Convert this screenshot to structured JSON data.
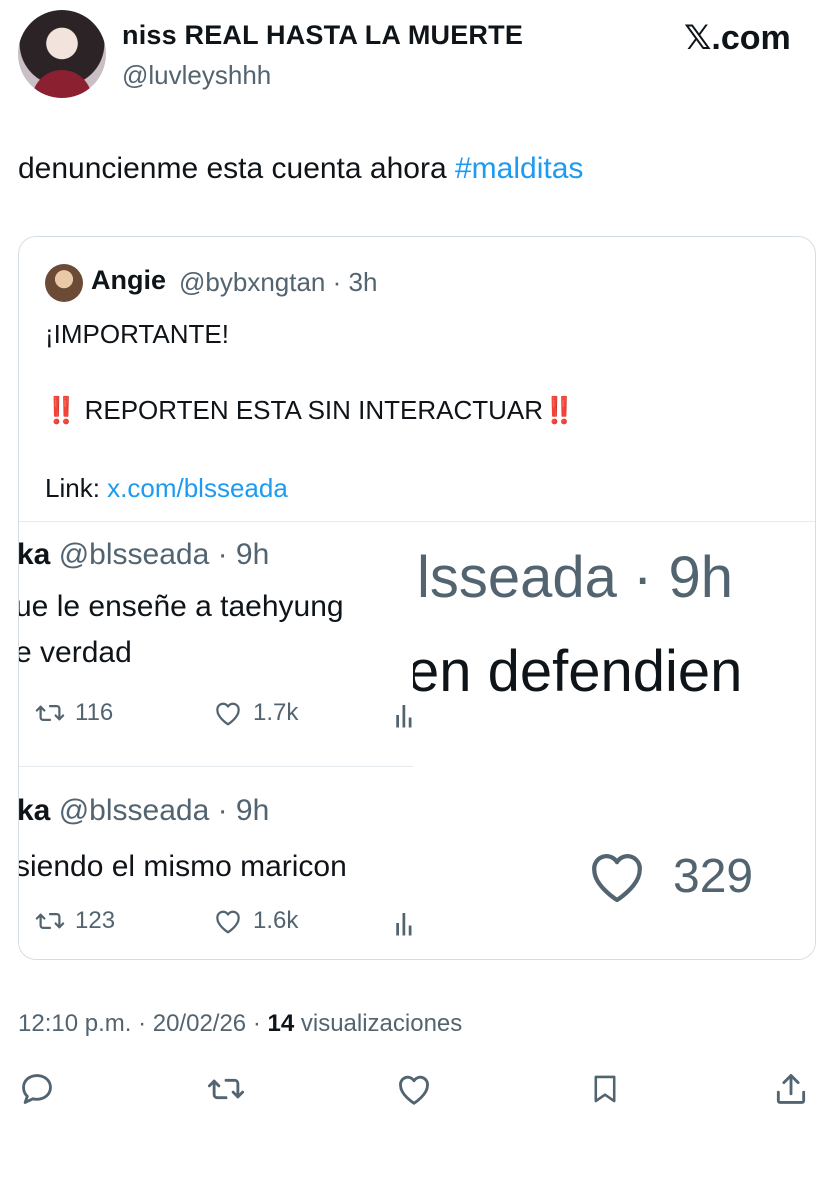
{
  "author": {
    "name": "niss REAL HASTA LA MUERTE",
    "handle": "@luvleyshhh"
  },
  "brand": "𝕏.com",
  "tweet": {
    "text": "denuncienme esta cuenta ahora ",
    "hashtag": "#malditas"
  },
  "quote": {
    "name": "Angie",
    "meta": "@bybxngtan · 3h",
    "line1": "¡IMPORTANTE!",
    "bang": "‼️",
    "line2": " REPORTEN ESTA SIN INTERACTUAR",
    "link_label": "Link: ",
    "link": "x.com/blsseada"
  },
  "embedded": {
    "tweets": [
      {
        "name": "ka",
        "handle": "@blsseada · 9h",
        "line1": "ue le enseñe a taehyung",
        "line2": "e verdad",
        "retweets": "116",
        "likes": "1.7k"
      },
      {
        "name": "ka",
        "handle": "@blsseada · 9h",
        "line1": "siendo el mismo maricon",
        "line2": "",
        "retweets": "123",
        "likes": "1.6k"
      }
    ],
    "zoom": {
      "handle": "lsseada · 9h",
      "text": "en defendien",
      "likes": "329"
    }
  },
  "footer": {
    "time": "12:10 p.m. · 20/02/26 · ",
    "views": "14",
    "views_label": " visualizaciones"
  },
  "actions": [
    "reply-icon",
    "retweet-icon",
    "like-icon",
    "bookmark-icon",
    "share-icon"
  ],
  "colors": {
    "link": "#1d9bf0",
    "secondary_text": "#536471",
    "primary_text": "#0f1419"
  }
}
